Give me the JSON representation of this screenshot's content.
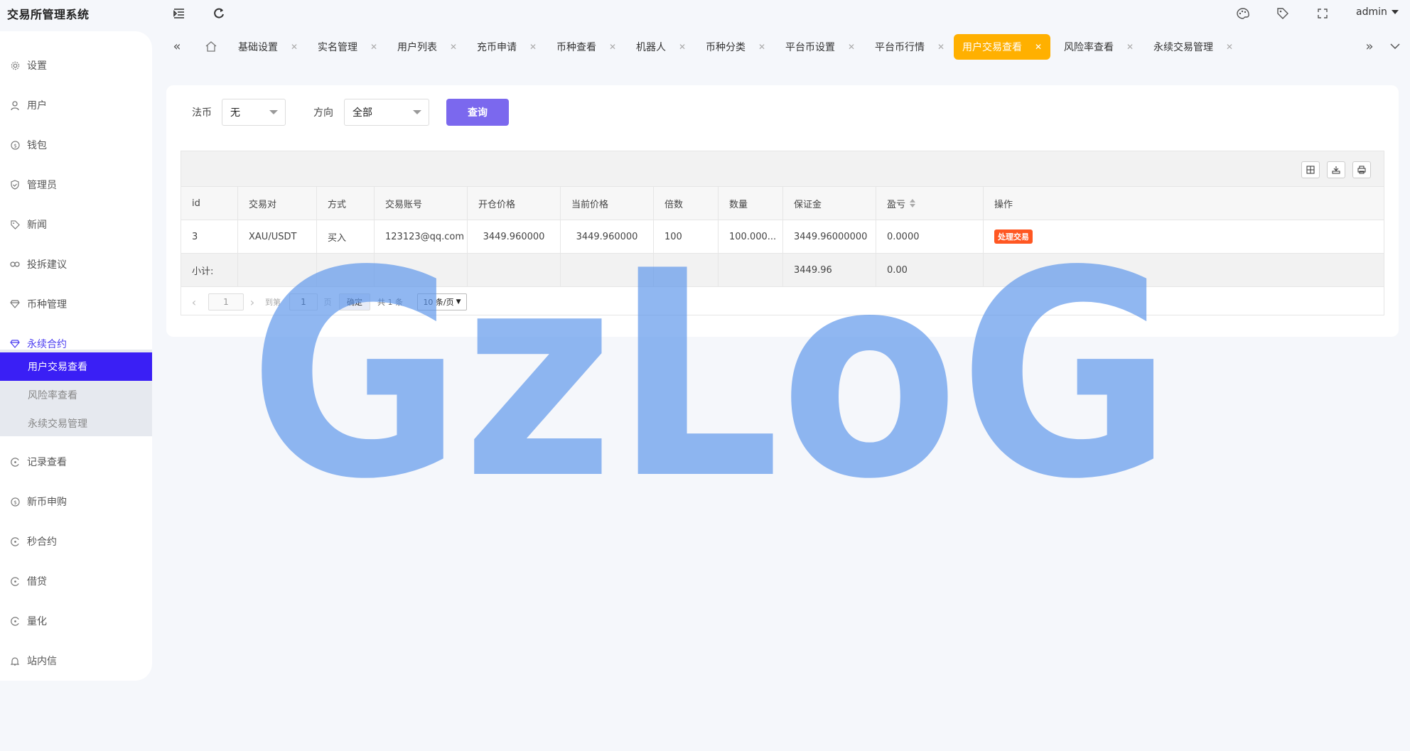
{
  "app": {
    "title": "交易所管理系统"
  },
  "header": {
    "user": "admin"
  },
  "sidebar": {
    "items": [
      {
        "label": "设置",
        "icon": "gear-icon"
      },
      {
        "label": "用户",
        "icon": "user-icon"
      },
      {
        "label": "钱包",
        "icon": "dollar-icon"
      },
      {
        "label": "管理员",
        "icon": "shield-icon"
      },
      {
        "label": "新闻",
        "icon": "tag-icon"
      },
      {
        "label": "投拆建议",
        "icon": "link-icon"
      },
      {
        "label": "币种管理",
        "icon": "diamond-icon"
      },
      {
        "label": "永续合约",
        "icon": "diamond-icon"
      }
    ],
    "submenu": [
      {
        "label": "用户交易查看"
      },
      {
        "label": "风险率查看"
      },
      {
        "label": "永续交易管理"
      }
    ],
    "items_after": [
      {
        "label": "记录查看",
        "icon": "circle-icon"
      },
      {
        "label": "新币申购",
        "icon": "dollar-icon"
      },
      {
        "label": "秒合约",
        "icon": "circle-icon"
      },
      {
        "label": "借贷",
        "icon": "circle-icon"
      },
      {
        "label": "量化",
        "icon": "circle-icon"
      },
      {
        "label": "站内信",
        "icon": "bell-icon"
      }
    ]
  },
  "tabs": [
    {
      "label": "基础设置"
    },
    {
      "label": "实名管理"
    },
    {
      "label": "用户列表"
    },
    {
      "label": "充币申请"
    },
    {
      "label": "币种查看"
    },
    {
      "label": "机器人"
    },
    {
      "label": "币种分类"
    },
    {
      "label": "平台币设置"
    },
    {
      "label": "平台币行情"
    },
    {
      "label": "用户交易查看"
    },
    {
      "label": "风险率查看"
    },
    {
      "label": "永续交易管理"
    }
  ],
  "filters": {
    "fiat_label": "法币",
    "fiat_value": "无",
    "direction_label": "方向",
    "direction_value": "全部",
    "query_button": "查询"
  },
  "table": {
    "columns": [
      "id",
      "交易对",
      "方式",
      "交易账号",
      "开仓价格",
      "当前价格",
      "倍数",
      "数量",
      "保证金",
      "盈亏",
      "操作"
    ],
    "rows": [
      {
        "id": "3",
        "pair": "XAU/USDT",
        "method": "买入",
        "account": "123123@qq.com",
        "open_price": "3449.960000",
        "current_price": "3449.960000",
        "multiple": "100",
        "quantity": "100.000...",
        "margin": "3449.96000000",
        "pnl": "0.0000",
        "action": "处理交易"
      }
    ],
    "total": {
      "label": "小计:",
      "margin": "3449.96",
      "pnl": "0.00"
    }
  },
  "pager": {
    "current": "1",
    "goto_label": "到第",
    "goto_value": "1",
    "page_unit": "页",
    "confirm": "确定",
    "total_text": "共 1 条",
    "page_size": "10 条/页"
  },
  "watermark": {
    "text": "GzLoG",
    "color": "#5b95ea"
  }
}
